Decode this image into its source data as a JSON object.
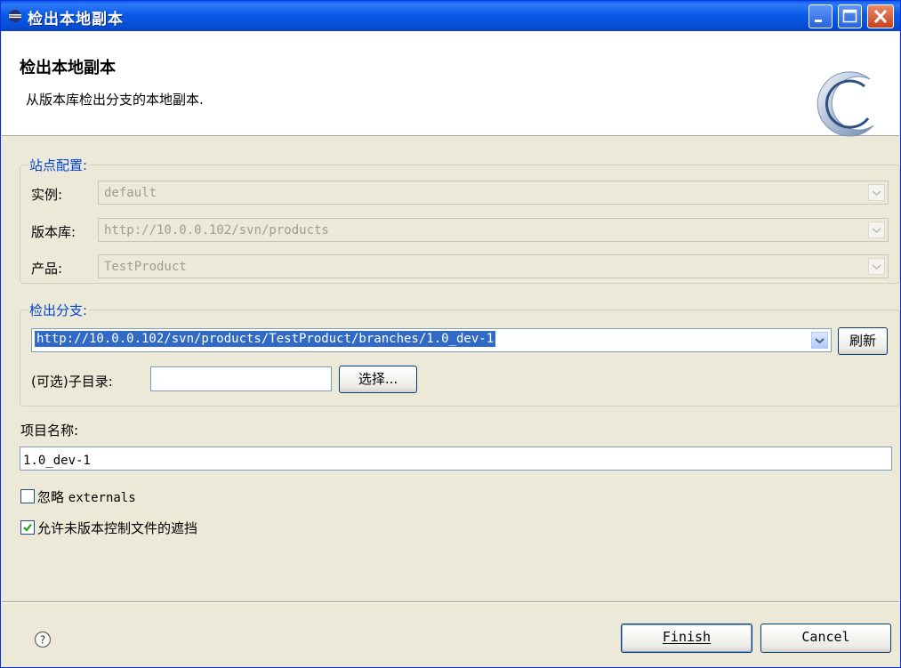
{
  "window": {
    "title": "检出本地副本"
  },
  "header": {
    "heading": "检出本地副本",
    "description": "从版本库检出分支的本地副本."
  },
  "site_config": {
    "legend": "站点配置:",
    "instance_label": "实例:",
    "instance_value": "default",
    "repository_label": "版本库:",
    "repository_value": "http://10.0.0.102/svn/products",
    "product_label": "产品:",
    "product_value": "TestProduct"
  },
  "checkout_branch": {
    "legend": "检出分支:",
    "branch_value": "http://10.0.0.102/svn/products/TestProduct/branches/1.0_dev-1",
    "refresh_label": "刷新",
    "subdir_label": "(可选)子目录:",
    "subdir_value": "",
    "choose_label": "选择..."
  },
  "project": {
    "name_label": "项目名称:",
    "name_value": "1.0_dev-1"
  },
  "options": {
    "ignore_externals_label_cn": "忽略",
    "ignore_externals_label_en": "externals",
    "ignore_externals_checked": false,
    "allow_unversioned_label": "允许未版本控制文件的遮挡",
    "allow_unversioned_checked": true
  },
  "footer": {
    "finish_label": "Finish",
    "cancel_label": "Cancel"
  },
  "colors": {
    "titlebar": "#0a5ae8",
    "legend": "#0046d5",
    "selection": "#316ac5",
    "dialog_bg": "#ece9d8"
  }
}
